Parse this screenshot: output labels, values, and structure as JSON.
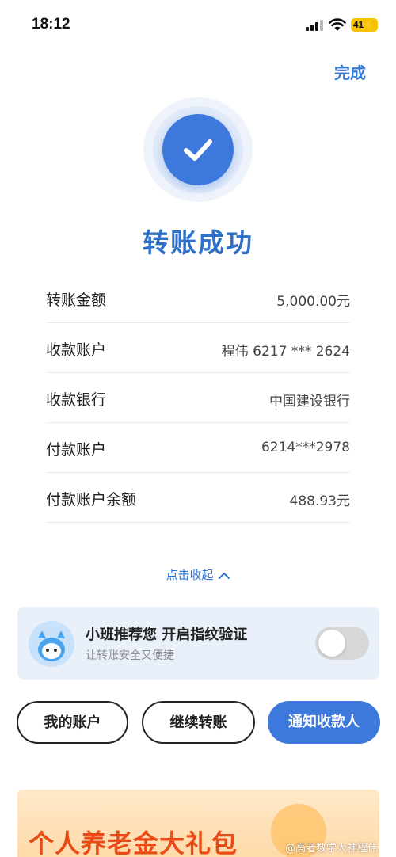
{
  "status_bar": {
    "time": "18:12",
    "battery": "41"
  },
  "header": {
    "done_label": "完成"
  },
  "result": {
    "title": "转账成功"
  },
  "details": [
    {
      "label": "转账金额",
      "value": "5,000.00元"
    },
    {
      "label": "收款账户",
      "value": "程伟 6217 *** 2624"
    },
    {
      "label": "收款银行",
      "value": "中国建设银行"
    },
    {
      "label": "付款账户",
      "value": "6214***2978"
    },
    {
      "label": "付款账户余额",
      "value": "488.93元"
    }
  ],
  "collapse": {
    "label": "点击收起"
  },
  "recommend": {
    "title": "小班推荐您 开启指纹验证",
    "subtitle": "让转账安全又便捷",
    "toggle_on": false
  },
  "actions": {
    "my_account": "我的账户",
    "continue_transfer": "继续转账",
    "notify_payee": "通知收款人"
  },
  "banner": {
    "text": "个人养老金大礼包"
  },
  "watermark": {
    "text": "@高者数学大神程伟"
  },
  "colors": {
    "accent": "#3d79dc",
    "link": "#2f78d8",
    "banner_text": "#e94b16"
  }
}
